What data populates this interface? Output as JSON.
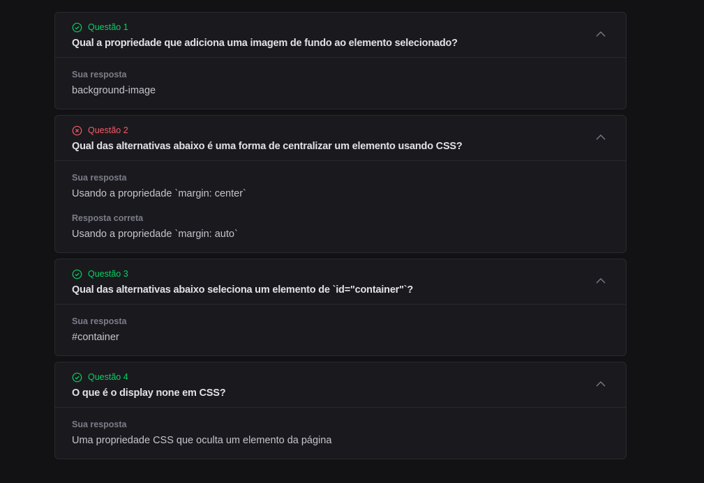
{
  "colors": {
    "success": "#04d361",
    "error": "#f75a68",
    "background": "#121214",
    "card": "#1a1a1e"
  },
  "questions": [
    {
      "status": "correct",
      "status_icon": "check-circle-icon",
      "label": "Questão 1",
      "title": "Qual a propriedade que adiciona uma imagem de fundo ao elemento selecionado?",
      "your_answer_label": "Sua resposta",
      "your_answer": "background-image"
    },
    {
      "status": "wrong",
      "status_icon": "x-circle-icon",
      "label": "Questão 2",
      "title": "Qual das alternativas abaixo é uma forma de centralizar um elemento usando CSS?",
      "your_answer_label": "Sua resposta",
      "your_answer": "Usando a propriedade `margin: center`",
      "correct_answer_label": "Resposta correta",
      "correct_answer": "Usando a propriedade `margin: auto`"
    },
    {
      "status": "correct",
      "status_icon": "check-circle-icon",
      "label": "Questão 3",
      "title": "Qual das alternativas abaixo seleciona um elemento de `id=\"container\"`?",
      "your_answer_label": "Sua resposta",
      "your_answer": "#container"
    },
    {
      "status": "correct",
      "status_icon": "check-circle-icon",
      "label": "Questão 4",
      "title": "O que é o display none em CSS?",
      "your_answer_label": "Sua resposta",
      "your_answer": "Uma propriedade CSS que oculta um elemento da página"
    }
  ]
}
